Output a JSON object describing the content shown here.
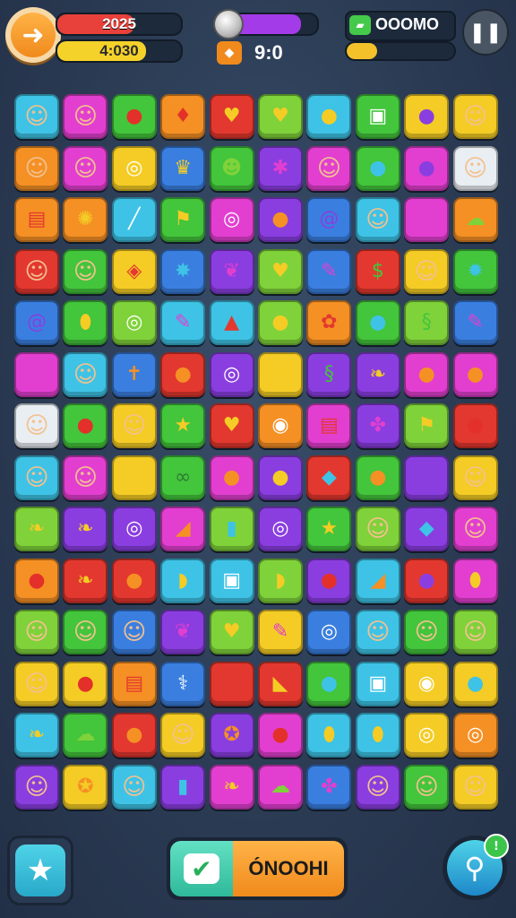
{
  "hud": {
    "score_text": "2025",
    "score_fill": 0.62,
    "score_color": "#e8403a",
    "sub_text": "4:030",
    "sub_fill": 0.72,
    "sub_color": "#f5d22a",
    "progress_fill": 0.82,
    "progress_color": "#a43be8",
    "time_text": "9:0",
    "money_text": "OOOMO",
    "energy_fill": 0.28,
    "energy_color": "#f5c12a"
  },
  "buttons": {
    "main_label": "ÓNOOHI"
  },
  "colors": {
    "cyan": "#3ec3e6",
    "magenta": "#e23fd0",
    "green": "#43c53c",
    "orange": "#f59024",
    "red": "#e3382f",
    "lime": "#7fd23a",
    "yellow": "#f4cc25",
    "purple": "#8a3ee0",
    "blue": "#3a7fe0",
    "white": "#e9eef3"
  },
  "board": [
    [
      [
        "cyan",
        "face"
      ],
      [
        "magenta",
        "face"
      ],
      [
        "green",
        "apple"
      ],
      [
        "orange",
        "candy"
      ],
      [
        "red",
        "heart"
      ],
      [
        "lime",
        "heart"
      ],
      [
        "cyan",
        "pear"
      ],
      [
        "green",
        "box"
      ],
      [
        "yellow",
        "plum"
      ],
      [
        "yellow",
        "face"
      ]
    ],
    [
      [
        "orange",
        "face"
      ],
      [
        "magenta",
        "face"
      ],
      [
        "yellow",
        "ring"
      ],
      [
        "blue",
        "crown"
      ],
      [
        "green",
        "smile"
      ],
      [
        "purple",
        "bug"
      ],
      [
        "magenta",
        "face"
      ],
      [
        "green",
        "drop"
      ],
      [
        "magenta",
        "plum"
      ],
      [
        "white",
        "face"
      ]
    ],
    [
      [
        "orange",
        "chest"
      ],
      [
        "orange",
        "sun"
      ],
      [
        "cyan",
        "stick"
      ],
      [
        "green",
        "flag"
      ],
      [
        "magenta",
        "ring"
      ],
      [
        "purple",
        "orange"
      ],
      [
        "blue",
        "swirl"
      ],
      [
        "cyan",
        "face"
      ],
      [
        "magenta",
        "eraser"
      ],
      [
        "orange",
        "ghost"
      ]
    ],
    [
      [
        "red",
        "face"
      ],
      [
        "green",
        "face"
      ],
      [
        "yellow",
        "tag"
      ],
      [
        "blue",
        "splat"
      ],
      [
        "purple",
        "bird"
      ],
      [
        "lime",
        "heart"
      ],
      [
        "blue",
        "pencil"
      ],
      [
        "red",
        "money"
      ],
      [
        "yellow",
        "face"
      ],
      [
        "green",
        "gear"
      ]
    ],
    [
      [
        "blue",
        "swirl"
      ],
      [
        "green",
        "lemon"
      ],
      [
        "lime",
        "ring"
      ],
      [
        "cyan",
        "pencil"
      ],
      [
        "cyan",
        "nose"
      ],
      [
        "lime",
        "pear"
      ],
      [
        "orange",
        "flower"
      ],
      [
        "green",
        "drop"
      ],
      [
        "lime",
        "snail"
      ],
      [
        "blue",
        "pencil"
      ]
    ],
    [
      [
        "magenta",
        "eraser"
      ],
      [
        "cyan",
        "face"
      ],
      [
        "blue",
        "gingerbread"
      ],
      [
        "red",
        "orange"
      ],
      [
        "purple",
        "ring"
      ],
      [
        "yellow",
        "sun"
      ],
      [
        "purple",
        "snail"
      ],
      [
        "purple",
        "leaf"
      ],
      [
        "magenta",
        "ball"
      ],
      [
        "magenta",
        "ball"
      ]
    ],
    [
      [
        "white",
        "face"
      ],
      [
        "green",
        "apple"
      ],
      [
        "yellow",
        "face"
      ],
      [
        "green",
        "star"
      ],
      [
        "red",
        "heart"
      ],
      [
        "orange",
        "camera"
      ],
      [
        "magenta",
        "chest"
      ],
      [
        "purple",
        "berry"
      ],
      [
        "lime",
        "flag"
      ],
      [
        "red",
        "apple"
      ]
    ],
    [
      [
        "cyan",
        "face"
      ],
      [
        "magenta",
        "face"
      ],
      [
        "yellow",
        "lemon"
      ],
      [
        "green",
        "caterpillar"
      ],
      [
        "magenta",
        "ball"
      ],
      [
        "purple",
        "pear"
      ],
      [
        "red",
        "gem"
      ],
      [
        "green",
        "orange"
      ],
      [
        "purple",
        "plum"
      ],
      [
        "yellow",
        "face"
      ]
    ],
    [
      [
        "lime",
        "leaf"
      ],
      [
        "purple",
        "leaf"
      ],
      [
        "purple",
        "ring"
      ],
      [
        "magenta",
        "carrot"
      ],
      [
        "lime",
        "bottle"
      ],
      [
        "purple",
        "ring"
      ],
      [
        "green",
        "star"
      ],
      [
        "lime",
        "face"
      ],
      [
        "purple",
        "gem"
      ],
      [
        "magenta",
        "face"
      ]
    ],
    [
      [
        "orange",
        "apple"
      ],
      [
        "red",
        "leaf"
      ],
      [
        "red",
        "orange"
      ],
      [
        "cyan",
        "banana"
      ],
      [
        "cyan",
        "box"
      ],
      [
        "lime",
        "banana"
      ],
      [
        "purple",
        "apple"
      ],
      [
        "cyan",
        "carrot"
      ],
      [
        "red",
        "plum"
      ],
      [
        "magenta",
        "lemon"
      ]
    ],
    [
      [
        "lime",
        "face"
      ],
      [
        "green",
        "face"
      ],
      [
        "blue",
        "face"
      ],
      [
        "purple",
        "bird"
      ],
      [
        "lime",
        "heart"
      ],
      [
        "yellow",
        "pencil"
      ],
      [
        "blue",
        "ring"
      ],
      [
        "cyan",
        "face"
      ],
      [
        "green",
        "face"
      ],
      [
        "lime",
        "face"
      ]
    ],
    [
      [
        "yellow",
        "face"
      ],
      [
        "yellow",
        "apple"
      ],
      [
        "orange",
        "chest"
      ],
      [
        "blue",
        "syringe"
      ],
      [
        "red",
        "tag"
      ],
      [
        "red",
        "cheese"
      ],
      [
        "green",
        "drop"
      ],
      [
        "cyan",
        "box"
      ],
      [
        "yellow",
        "camera"
      ],
      [
        "yellow",
        "drop"
      ]
    ],
    [
      [
        "cyan",
        "leaf"
      ],
      [
        "green",
        "ghost"
      ],
      [
        "red",
        "orange"
      ],
      [
        "yellow",
        "face"
      ],
      [
        "purple",
        "cookie"
      ],
      [
        "magenta",
        "apple"
      ],
      [
        "cyan",
        "lemon"
      ],
      [
        "cyan",
        "lemon"
      ],
      [
        "yellow",
        "ring"
      ],
      [
        "orange",
        "ring"
      ]
    ],
    [
      [
        "purple",
        "face"
      ],
      [
        "yellow",
        "cookie"
      ],
      [
        "cyan",
        "face"
      ],
      [
        "purple",
        "bottle"
      ],
      [
        "magenta",
        "leaf"
      ],
      [
        "magenta",
        "ghost"
      ],
      [
        "blue",
        "berry"
      ],
      [
        "purple",
        "face"
      ],
      [
        "green",
        "face"
      ],
      [
        "yellow",
        "face"
      ]
    ]
  ],
  "glyphs": {
    "face": "☺",
    "apple": "●",
    "candy": "♦",
    "heart": "♥",
    "pear": "●",
    "box": "▣",
    "plum": "●",
    "ring": "◎",
    "crown": "♛",
    "smile": "☻",
    "bug": "✱",
    "drop": "●",
    "chest": "▤",
    "sun": "✺",
    "stick": "╱",
    "flag": "⚑",
    "orange": "●",
    "swirl": "@",
    "eraser": "▰",
    "ghost": "☁",
    "tag": "◈",
    "splat": "✸",
    "bird": "❦",
    "pencil": "✎",
    "money": "$",
    "gear": "✹",
    "lemon": "⬮",
    "nose": "▲",
    "flower": "✿",
    "snail": "§",
    "gingerbread": "✝",
    "ball": "●",
    "leaf": "❧",
    "star": "★",
    "camera": "◉",
    "berry": "✤",
    "caterpillar": "∞",
    "gem": "◆",
    "carrot": "◢",
    "bottle": "▮",
    "banana": "◗",
    "syringe": "⚕",
    "cheese": "◣",
    "cookie": "✪"
  },
  "glyph_colors": {
    "face": "#f3c18f",
    "apple": "#e3302a",
    "candy": "#e3302a",
    "heart": "#f4cc25",
    "pear": "#f4cc25",
    "box": "#ffffff",
    "plum": "#8a3ee0",
    "ring": "#ffffff",
    "crown": "#f4cc25",
    "smile": "#7fd23a",
    "bug": "#e23fd0",
    "drop": "#3ec3e6",
    "chest": "#e3382f",
    "sun": "#f4cc25",
    "stick": "#ffffff",
    "flag": "#f4cc25",
    "orange": "#f59024",
    "swirl": "#8a3ee0",
    "eraser": "#e23fd0",
    "ghost": "#7fd23a",
    "tag": "#e3382f",
    "splat": "#3ec3e6",
    "bird": "#e23fd0",
    "pencil": "#e23fd0",
    "money": "#43c53c",
    "gear": "#3ec3e6",
    "lemon": "#f4cc25",
    "nose": "#e3382f",
    "flower": "#e3382f",
    "snail": "#43c53c",
    "gingerbread": "#f59024",
    "ball": "#f59024",
    "leaf": "#f4cc25",
    "star": "#f4cc25",
    "camera": "#ffffff",
    "berry": "#e23fd0",
    "caterpillar": "#2e7d32",
    "gem": "#3ec3e6",
    "carrot": "#f59024",
    "bottle": "#3ec3e6",
    "banana": "#f4cc25",
    "syringe": "#ffffff",
    "cheese": "#f4cc25",
    "cookie": "#f59024"
  }
}
